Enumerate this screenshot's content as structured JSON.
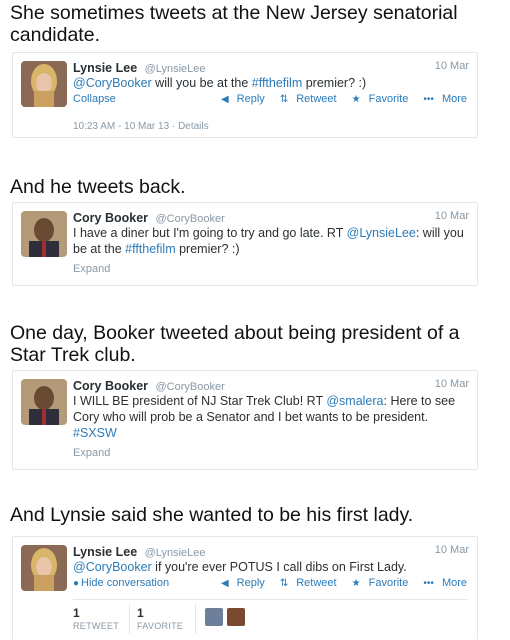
{
  "captions": {
    "c1": "She sometimes tweets at the New Jersey senatorial candidate.",
    "c2": "And he tweets back.",
    "c3": "One day, Booker tweeted about being president of a Star Trek club.",
    "c4": "And Lynsie said she wanted to be his first lady."
  },
  "actions": {
    "reply": "Reply",
    "retweet": "Retweet",
    "favorite": "Favorite",
    "more": "More"
  },
  "tweet1": {
    "name": "Lynsie Lee",
    "handle": "@LynsieLee",
    "date": "10 Mar",
    "mention": "@CoryBooker",
    "text_a": " will you be at the ",
    "hashtag": "#ffthefilm",
    "text_b": " premier? :)",
    "collapse": "Collapse",
    "timestamp": "10:23 AM - 10 Mar 13",
    "details": "Details"
  },
  "tweet2": {
    "name": "Cory Booker",
    "handle": "@CoryBooker",
    "date": "10 Mar",
    "text_a": "I have a diner but I'm going to try and go late. RT ",
    "mention": "@LynsieLee",
    "text_b": ": will you be at the ",
    "hashtag": "#ffthefilm",
    "text_c": " premier? :)",
    "expand": "Expand"
  },
  "tweet3": {
    "name": "Cory Booker",
    "handle": "@CoryBooker",
    "date": "10 Mar",
    "text_a": "I WILL BE president of NJ Star Trek Club! RT ",
    "mention": "@smalera",
    "text_b": ": Here to see Cory who will prob be a Senator and I bet wants to be president. ",
    "hashtag": "#SXSW",
    "expand": "Expand"
  },
  "tweet4": {
    "name": "Lynsie Lee",
    "handle": "@LynsieLee",
    "date": "10 Mar",
    "mention": "@CoryBooker",
    "text_a": " if you're ever POTUS I call dibs on First Lady.",
    "hide": "Hide conversation",
    "retweets": "1",
    "retweets_label": "RETWEET",
    "favorites": "1",
    "favorites_label": "FAVORITE"
  },
  "colors": {
    "link": "#2b7bb9",
    "muted": "#8899a6",
    "text": "#292f33"
  }
}
